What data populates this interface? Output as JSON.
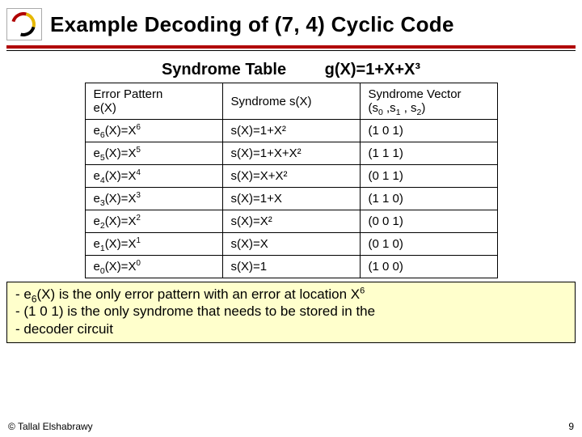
{
  "header": {
    "title": "Example Decoding of (7, 4) Cyclic Code"
  },
  "table_heading": {
    "label": "Syndrome Table",
    "gx": "g(X)=1+X+X³"
  },
  "columns": {
    "c1a": "Error Pattern",
    "c1b": "e(X)",
    "c2": "Syndrome s(X)",
    "c3a": "Syndrome Vector",
    "c3b_open": "(s",
    "c3b_close": ")"
  },
  "rows": {
    "r6": {
      "eidx": "6",
      "epow": "6",
      "s": "s(X)=1+X²",
      "v": "(1 0 1)"
    },
    "r5": {
      "eidx": "5",
      "epow": "5",
      "s": "s(X)=1+X+X²",
      "v": "(1 1 1)"
    },
    "r4": {
      "eidx": "4",
      "epow": "4",
      "s": "s(X)=X+X²",
      "v": "(0 1 1)"
    },
    "r3": {
      "eidx": "3",
      "epow": "3",
      "s": "s(X)=1+X",
      "v": "(1 1 0)"
    },
    "r2": {
      "eidx": "2",
      "epow": "2",
      "s": "s(X)=X²",
      "v": "(0 0 1)"
    },
    "r1": {
      "eidx": "1",
      "epow": "1",
      "s": "s(X)=X",
      "v": "(0 1 0)"
    },
    "r0": {
      "eidx": "0",
      "epow": "0",
      "s": "s(X)=1",
      "v": "(1 0 0)"
    }
  },
  "note": {
    "l1a": "- e",
    "l1b": "(X) is the only error pattern with an error at location X",
    "l2": "- (1 0 1) is the only syndrome that needs to be stored in the",
    "l3": "- decoder circuit"
  },
  "footer": {
    "copyright": "© Tallal Elshabrawy",
    "page": "9"
  },
  "idx": {
    "six": "6",
    "zero": "0",
    "one": "1",
    "two": "2"
  },
  "chart_data": {
    "type": "table",
    "title": "Syndrome Table for (7,4) Cyclic Code, g(X)=1+X+X^3",
    "columns": [
      "Error Pattern e(X)",
      "Syndrome s(X)",
      "Syndrome Vector (s0,s1,s2)"
    ],
    "rows": [
      [
        "e6(X)=X^6",
        "s(X)=1+X^2",
        "(1 0 1)"
      ],
      [
        "e5(X)=X^5",
        "s(X)=1+X+X^2",
        "(1 1 1)"
      ],
      [
        "e4(X)=X^4",
        "s(X)=X+X^2",
        "(0 1 1)"
      ],
      [
        "e3(X)=X^3",
        "s(X)=1+X",
        "(1 1 0)"
      ],
      [
        "e2(X)=X^2",
        "s(X)=X^2",
        "(0 0 1)"
      ],
      [
        "e1(X)=X^1",
        "s(X)=X",
        "(0 1 0)"
      ],
      [
        "e0(X)=X^0",
        "s(X)=1",
        "(1 0 0)"
      ]
    ]
  }
}
